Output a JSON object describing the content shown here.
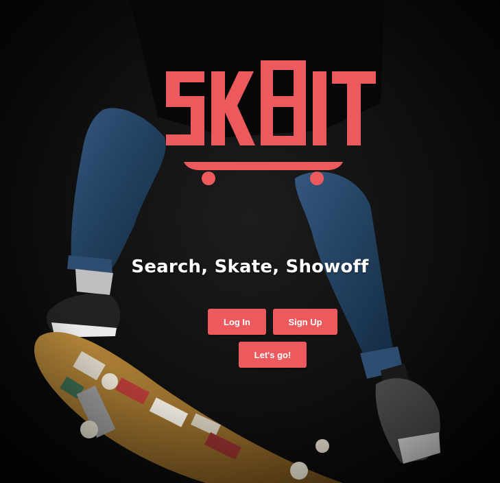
{
  "brand": {
    "logo_text": "SK8IT",
    "accent_color": "#ec5a5e",
    "logo_icon": "skateboard-icon"
  },
  "hero": {
    "tagline": "Search, Skate, Showoff",
    "background": "photo of skateboarder doing a trick"
  },
  "actions": {
    "login_label": "Log In",
    "signup_label": "Sign Up",
    "go_label": "Let's go!"
  }
}
